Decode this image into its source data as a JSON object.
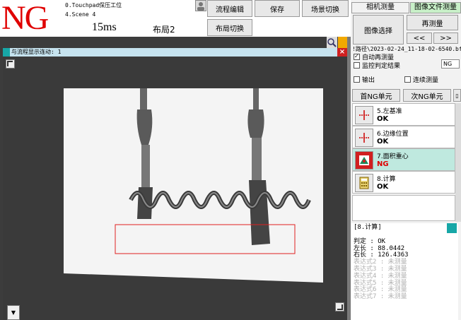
{
  "header": {
    "status": "NG",
    "scene_line1": "0.Touchpad保压工位",
    "scene_line2": "4.Scene 4",
    "time": "15ms",
    "layout": "布局2",
    "buttons": {
      "flow_edit": "流程编辑",
      "save": "保存",
      "scene_switch": "场景切换",
      "layout_switch": "布局切换"
    }
  },
  "viewer": {
    "info": "与流程显示连动: 1",
    "close": "×"
  },
  "right_panel": {
    "tabs": [
      "相机测量",
      "图像文件测量"
    ],
    "image_select": "图像选择",
    "remeasure": "再测量",
    "prev": "<<",
    "next": ">>",
    "path": "!路径\\2023-02-24_11-18-02-6540.bf",
    "auto_remeasure": "自动再测量",
    "monitor_result": "监控判定结果",
    "monitor_value": "NG",
    "output": "输出",
    "continuous": "连续测量",
    "first_ng": "首NG单元",
    "next_ng": "次NG单元",
    "units": [
      {
        "name": "5.左基准",
        "status": "OK",
        "icon": "crosshair-icon"
      },
      {
        "name": "6.边缘位置",
        "status": "OK",
        "icon": "crosshair-icon"
      },
      {
        "name": "7.面积重心",
        "status": "NG",
        "icon": "area-icon"
      },
      {
        "name": "8.计算",
        "status": "OK",
        "icon": "calculator-icon"
      }
    ],
    "result": {
      "title": "[8.计算]",
      "lines": [
        "判定 : OK",
        "左长 : 88.0442",
        "右长 : 126.4363"
      ],
      "dim_lines": [
        "表达式2 : 未测量",
        "表达式3 : 未测量",
        "表达式4 : 未测量",
        "表达式5 : 未测量",
        "表达式6 : 未测量",
        "表达式7 : 未测量"
      ]
    }
  },
  "colors": {
    "ng_red": "#e00000",
    "selected_row": "#bfe9df",
    "accent_cyan": "#17a7a7",
    "warn_orange": "#f2a900"
  }
}
